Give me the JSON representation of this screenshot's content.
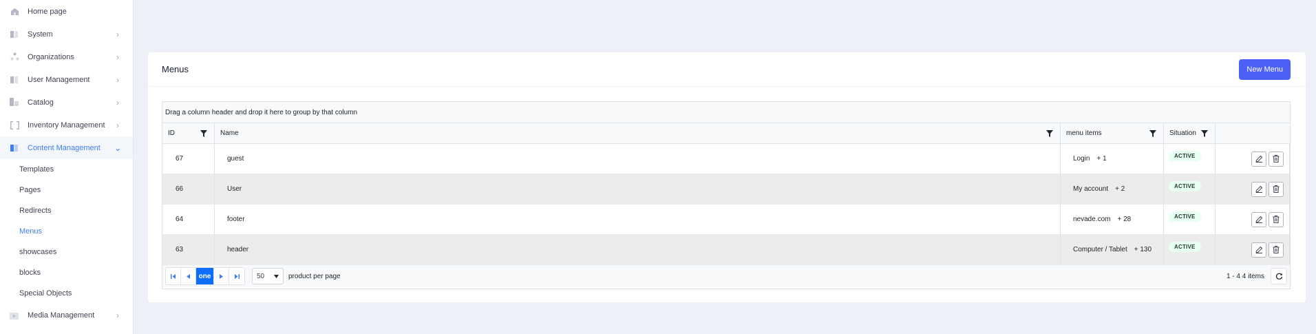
{
  "sidebar": {
    "items": [
      {
        "label": "Home page",
        "icon": "home-icon",
        "chevron": ""
      },
      {
        "label": "System",
        "icon": "system-icon",
        "chevron": "›"
      },
      {
        "label": "Organizations",
        "icon": "organizations-icon",
        "chevron": "›"
      },
      {
        "label": "User Management",
        "icon": "user-management-icon",
        "chevron": "›"
      },
      {
        "label": "Catalog",
        "icon": "catalog-icon",
        "chevron": "›"
      },
      {
        "label": "Inventory Management",
        "icon": "inventory-icon",
        "chevron": "›"
      },
      {
        "label": "Content Management",
        "icon": "content-management-icon",
        "chevron": "⌄",
        "active": true
      }
    ],
    "sub_items": [
      {
        "label": "Templates"
      },
      {
        "label": "Pages"
      },
      {
        "label": "Redirects"
      },
      {
        "label": "Menus",
        "active": true
      },
      {
        "label": "showcases"
      },
      {
        "label": "blocks"
      },
      {
        "label": "Special Objects"
      }
    ],
    "media": {
      "label": "Media Management",
      "icon": "media-management-icon",
      "chevron": "›"
    }
  },
  "card": {
    "title": "Menus",
    "new_button": "New Menu"
  },
  "grid": {
    "group_hint": "Drag a column header and drop it here to group by that column",
    "columns": {
      "id": "ID",
      "name": "Name",
      "menu_items": "menu items",
      "situation": "Situation"
    },
    "rows": [
      {
        "id": "67",
        "name": "guest",
        "menu_item": "Login",
        "extra": "+ 1",
        "status": "ACTIVE"
      },
      {
        "id": "66",
        "name": "User",
        "menu_item": "My account",
        "extra": "+ 2",
        "status": "ACTIVE"
      },
      {
        "id": "64",
        "name": "footer",
        "menu_item": "nevade.com",
        "extra": "+ 28",
        "status": "ACTIVE"
      },
      {
        "id": "63",
        "name": "header",
        "menu_item": "Computer / Tablet",
        "extra": "+ 130",
        "status": "ACTIVE"
      }
    ]
  },
  "pager": {
    "current_page": "one",
    "page_size": "50",
    "per_page_label": "product per page",
    "info": "1 - 4 4 items"
  },
  "colors": {
    "accent": "#3e7df5",
    "primary_button": "#4d60f5",
    "page_background": "#eef0f7",
    "badge_background": "#e8fff3"
  }
}
